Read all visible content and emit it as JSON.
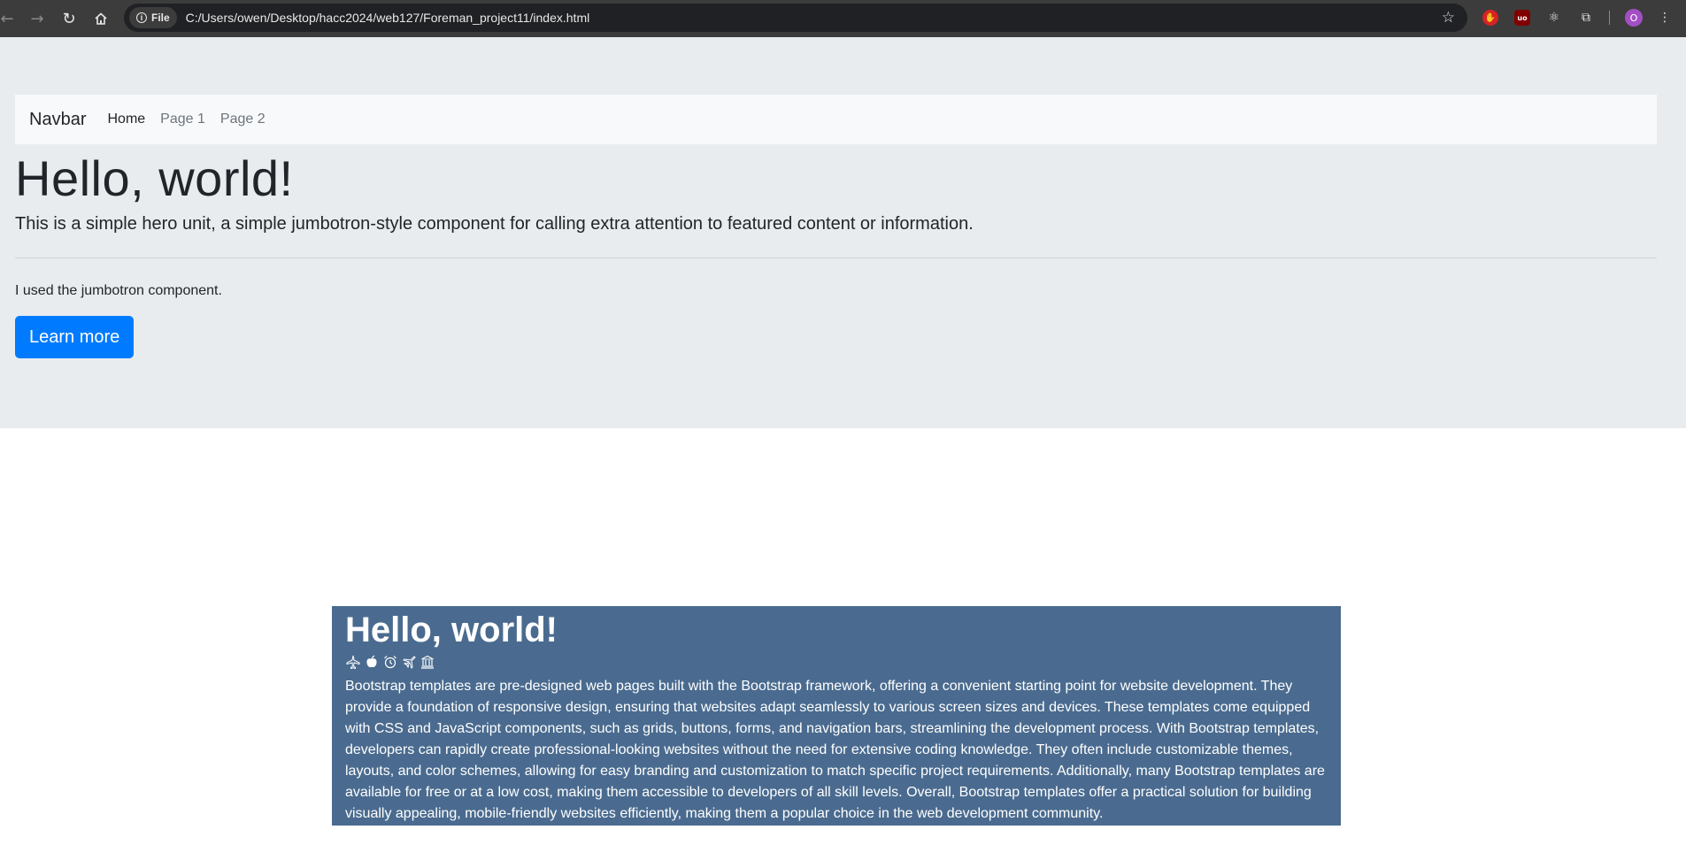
{
  "browser": {
    "back_icon": "arrow-left-icon",
    "forward_icon": "arrow-right-icon",
    "reload_icon": "reload-icon",
    "home_icon": "home-icon",
    "chip_label": "File",
    "url": "C:/Users/owen/Desktop/hacc2024/web127/Foreman_project11/index.html",
    "profile_initial": "O"
  },
  "navbar": {
    "brand": "Navbar",
    "links": [
      {
        "label": "Home",
        "active": true
      },
      {
        "label": "Page 1",
        "active": false
      },
      {
        "label": "Page 2",
        "active": false
      }
    ]
  },
  "jumbotron": {
    "title": "Hello, world!",
    "lead": "This is a simple hero unit, a simple jumbotron-style component for calling extra attention to featured content or information.",
    "text": "I used the jumbotron component.",
    "button": "Learn more",
    "button_color": "#007bff",
    "background": "#e9ecef"
  },
  "card": {
    "title": "Hello, world!",
    "icons": [
      "airplane-icon",
      "apple-icon",
      "alarm-icon",
      "airplane-engines-icon",
      "bank-icon"
    ],
    "paragraph": "Bootstrap templates are pre-designed web pages built with the Bootstrap framework, offering a convenient starting point for website development. They provide a foundation of responsive design, ensuring that websites adapt seamlessly to various screen sizes and devices. These templates come equipped with CSS and JavaScript components, such as grids, buttons, forms, and navigation bars, streamlining the development process. With Bootstrap templates, developers can rapidly create professional-looking websites without the need for extensive coding knowledge. They often include customizable themes, layouts, and color schemes, allowing for easy branding and customization to match specific project requirements. Additionally, many Bootstrap templates are available for free or at a low cost, making them accessible to developers of all skill levels. Overall, Bootstrap templates offer a practical solution for building visually appealing, mobile-friendly websites efficiently, making them a popular choice in the web development community.",
    "background": "#4a6b8f"
  }
}
